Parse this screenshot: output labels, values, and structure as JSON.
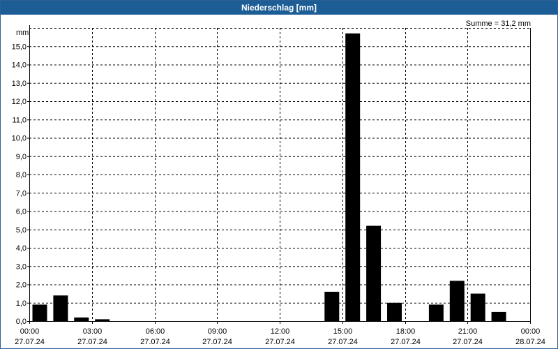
{
  "chart_data": {
    "type": "bar",
    "title": "Niederschlag [mm]",
    "ylabel": "mm",
    "summary": "Summe = 31,2 mm",
    "ylim": [
      0,
      16
    ],
    "yticks": [
      "0,0",
      "1,0",
      "2,0",
      "3,0",
      "4,0",
      "5,0",
      "6,0",
      "7,0",
      "8,0",
      "9,0",
      "10,0",
      "11,0",
      "12,0",
      "13,0",
      "14,0",
      "15,0"
    ],
    "xlim_hours": [
      0,
      24
    ],
    "xticks": [
      {
        "time": "00:00",
        "date": "27.07.24"
      },
      {
        "time": "03:00",
        "date": "27.07.24"
      },
      {
        "time": "06:00",
        "date": "27.07.24"
      },
      {
        "time": "09:00",
        "date": "27.07.24"
      },
      {
        "time": "12:00",
        "date": "27.07.24"
      },
      {
        "time": "15:00",
        "date": "27.07.24"
      },
      {
        "time": "18:00",
        "date": "27.07.24"
      },
      {
        "time": "21:00",
        "date": "27.07.24"
      },
      {
        "time": "00:00",
        "date": "28.07.24"
      }
    ],
    "categories": [
      "00:00",
      "01:00",
      "02:00",
      "03:00",
      "04:00",
      "05:00",
      "06:00",
      "07:00",
      "08:00",
      "09:00",
      "10:00",
      "11:00",
      "12:00",
      "13:00",
      "14:00",
      "15:00",
      "16:00",
      "17:00",
      "18:00",
      "19:00",
      "20:00",
      "21:00",
      "22:00",
      "23:00"
    ],
    "values": [
      0.9,
      1.4,
      0.2,
      0.1,
      0,
      0,
      0,
      0,
      0,
      0,
      0,
      0,
      0,
      0,
      1.6,
      15.7,
      5.2,
      1.0,
      0,
      0.9,
      2.2,
      1.5,
      0.5,
      0
    ],
    "grid": true,
    "bar_color": "#000000"
  }
}
